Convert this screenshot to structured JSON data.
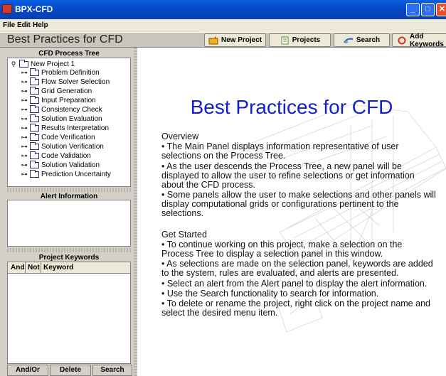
{
  "window": {
    "title": "BPX-CFD",
    "icon": "app-icon"
  },
  "menu": {
    "items": [
      "File",
      "Edit",
      "Help"
    ]
  },
  "header": {
    "title": "Best Practices for CFD",
    "buttons": [
      {
        "label": "New Project",
        "icon": "new-project-icon"
      },
      {
        "label": "Projects",
        "icon": "projects-icon"
      },
      {
        "label": "Search",
        "icon": "search-icon"
      },
      {
        "label": "Add Keywords",
        "icon": "add-keywords-icon"
      }
    ]
  },
  "process_tree": {
    "title": "CFD Process Tree",
    "root": "New Project 1",
    "items": [
      "Problem Definition",
      "Flow Solver Selection",
      "Grid Generation",
      "Input Preparation",
      "Consistency Check",
      "Solution Evaluation",
      "Results Interpretation",
      "Code Verification",
      "Solution Verification",
      "Code Validation",
      "Solution Validation",
      "Prediction Uncertainty"
    ]
  },
  "alert_panel": {
    "title": "Alert Information"
  },
  "keywords_panel": {
    "title": "Project Keywords",
    "columns": [
      "And",
      "Not",
      "Keyword"
    ],
    "buttons": [
      "And/Or",
      "Delete",
      "Search"
    ]
  },
  "main": {
    "title": "Best Practices for CFD",
    "overview_heading": "Overview",
    "overview": [
      "• The Main Panel displays information representative of user selections on the Process Tree.",
      "• As the user descends the Process Tree, a new panel will be displayed to allow the user to refine selections or get information about the CFD process.",
      "• Some panels allow the user to make selections and other panels will display computational grids or configurations pertinent to the selections."
    ],
    "get_started_heading": "Get Started",
    "get_started": [
      "• To continue working on this project, make a selection on the Process Tree to display a selection panel in this window.",
      "• As selections are made on the selection panel, keywords are added to the system, rules are evaluated, and alerts are presented.",
      "• Select an alert from the Alert panel to display the alert information.",
      "• Use the Search functionality to search for information.",
      "• To delete or rename the project, right click on the project name and select the desired menu item."
    ]
  },
  "colors": {
    "title_blue": "#1620c8",
    "titlebar": "#0548c8"
  }
}
